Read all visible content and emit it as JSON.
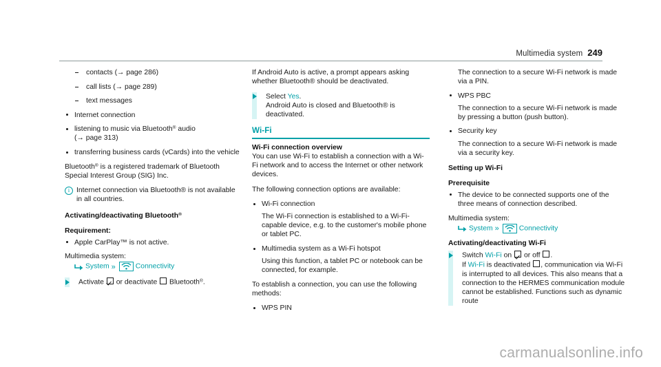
{
  "header": {
    "title": "Multimedia system",
    "page_number": "249"
  },
  "colors": {
    "accent_teal": "#00a0a8",
    "step_bar": "#d6f4f4",
    "rule": "#8d9a9a",
    "watermark": "#adadad"
  },
  "icons": {
    "info": "i",
    "nav_arrow": "turn-arrow-icon",
    "double_chevron": "»",
    "wifi": "wifi-icon"
  },
  "column1": {
    "dash_items": [
      "contacts (→ page 286)",
      "call lists (→ page 289)",
      "text messages"
    ],
    "bullets": [
      {
        "text": "Internet connection"
      },
      {
        "text": "listening to music via Bluetooth",
        "reg": true,
        "text_after": " audio",
        "second_line": "(→ page 313)"
      },
      {
        "text": "transferring business cards (vCards) into the vehicle"
      }
    ],
    "trademark_para": "is a registered trademark of Bluetooth Special Interest Group (SIG) Inc.",
    "trademark_lead": "Bluetooth",
    "note": "Internet connection via Bluetooth® is not available in all countries.",
    "heading_activating": "Activating/deactivating Bluetooth",
    "requirement_heading": "Requirement:",
    "requirement_bullet": "Apple CarPlay™ is not active.",
    "multimedia_label": "Multimedia system:",
    "navpath": {
      "first": "System",
      "second": "Connectivity"
    },
    "step": {
      "prefix": "Activate",
      "middle": "or deactivate",
      "suffix": "Bluetooth",
      "end": "."
    }
  },
  "column2": {
    "android_para": "If Android Auto is active, a prompt appears asking whether Bluetooth® should be deactivated.",
    "step": {
      "line1_prefix": "Select",
      "line1_link": "Yes",
      "line1_end": ".",
      "line2": "Android Auto is closed and Bluetooth® is deactivated."
    },
    "section_heading": "Wi-Fi",
    "sub_heading": "Wi-Fi connection overview",
    "overview_para": "You can use Wi-Fi to establish a connection with a Wi-Fi network and to access the Internet or other network devices.",
    "options_intro": "The following connection options are available:",
    "options": [
      {
        "label": "Wi-Fi connection",
        "detail": "The Wi-Fi connection is established to a Wi-Fi-capable device, e.g. to the customer's mobile phone or tablet PC."
      },
      {
        "label": "Multimedia system as a Wi-Fi hotspot",
        "detail": "Using this function, a tablet PC or notebook can be connected, for example."
      }
    ],
    "methods_intro": "To establish a connection, you can use the following methods:",
    "method_first": "WPS PIN"
  },
  "column3": {
    "first_detail": "The connection to a secure Wi-Fi network is made via a PIN.",
    "methods": [
      {
        "label": "WPS PBC",
        "detail": "The connection to a secure Wi-Fi network is made by pressing a button (push button)."
      },
      {
        "label": "Security key",
        "detail": "The connection to a secure Wi-Fi network is made via a security key."
      }
    ],
    "setting_up_heading": "Setting up Wi-Fi",
    "prerequisite_heading": "Prerequisite",
    "prerequisite_bullet": "The device to be connected supports one of the three means of connection described.",
    "multimedia_label": "Multimedia system:",
    "navpath": {
      "first": "System",
      "second": "Connectivity"
    },
    "activating_heading": "Activating/deactivating Wi-Fi",
    "step": {
      "line1_prefix": "Switch",
      "line1_link": "Wi-Fi",
      "line1_mid": "on",
      "line1_or": "or off",
      "line1_end": ".",
      "line2_prefix": "If",
      "line2_link": "Wi-Fi",
      "line2_mid": "is deactivated",
      "line2_rest": ", communication via Wi-Fi is interrupted to all devices. This also means that a connection to the HERMES communication module cannot be established. Functions such as dynamic route"
    }
  },
  "watermark": "carmanualsonline.info"
}
